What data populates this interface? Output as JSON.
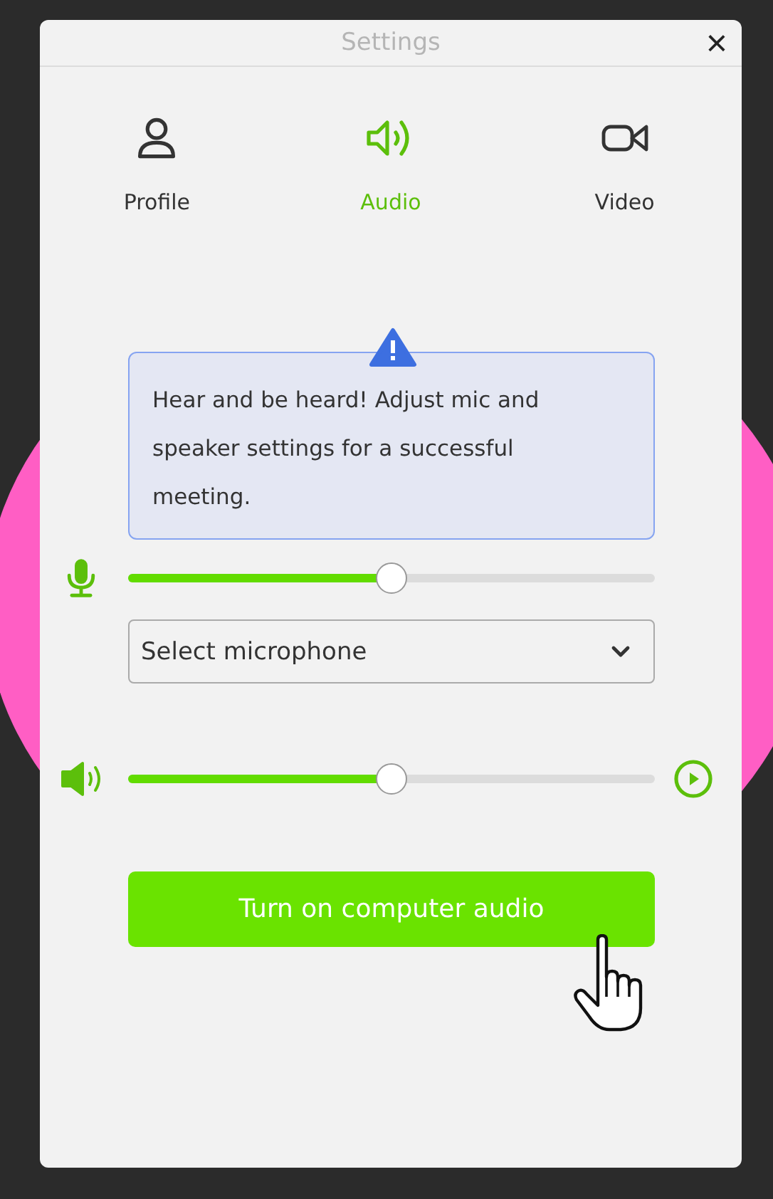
{
  "window": {
    "title": "Settings",
    "close": "×"
  },
  "tabs": [
    {
      "label": "Profile",
      "kind": "profile",
      "selected": false
    },
    {
      "label": "Audio",
      "kind": "audio",
      "selected": true
    },
    {
      "label": "Video",
      "kind": "video",
      "selected": false
    }
  ],
  "notice": {
    "text": "Hear and be heard! Adjust mic and speaker settings for a successful meeting."
  },
  "microphone": {
    "level": 0.5,
    "select": "Select microphone"
  },
  "speaker": {
    "level": 0.5
  },
  "button": {
    "label": "Turn on computer audio"
  }
}
